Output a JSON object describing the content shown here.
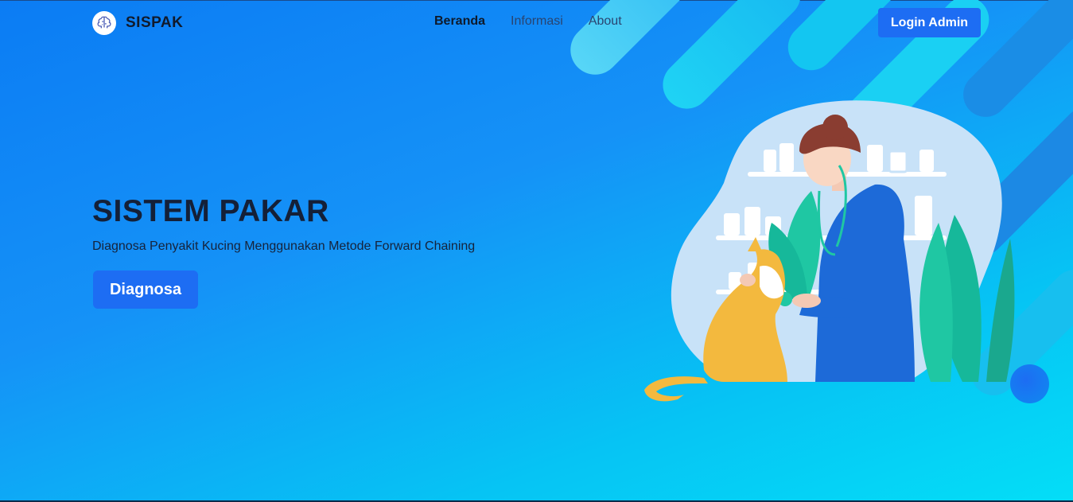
{
  "app": {
    "brand_name": "SISPAK",
    "logo_icon": "brain-icon"
  },
  "nav": {
    "items": [
      {
        "label": "Beranda",
        "active": true
      },
      {
        "label": "Informasi",
        "active": false
      },
      {
        "label": "About",
        "active": false
      }
    ],
    "login_label": "Login Admin"
  },
  "hero": {
    "title": "SISTEM PAKAR",
    "subtitle": "Diagnosa Penyakit Kucing Menggunakan Metode Forward Chaining",
    "cta_label": "Diagnosa",
    "illustration_icon": "vet-with-cat-illustration"
  },
  "colors": {
    "accent": "#1d6df3",
    "bg_start": "#0b7cf4",
    "bg_end": "#04def7",
    "text_dark": "#142038"
  }
}
